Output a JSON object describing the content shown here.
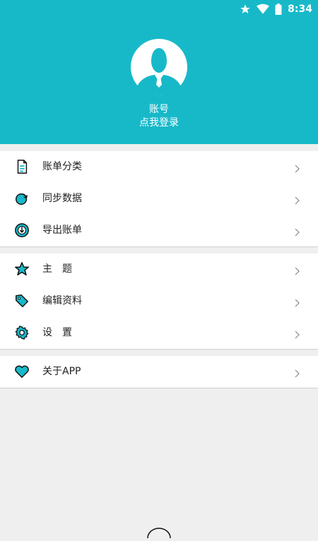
{
  "status_bar": {
    "time": "8:34",
    "icons": [
      "star-icon",
      "wifi-icon",
      "battery-icon"
    ]
  },
  "profile": {
    "title": "账号",
    "subtitle": "点我登录",
    "accent_color": "#17b9c9"
  },
  "menu": {
    "group1": [
      {
        "label": "账单分类",
        "icon": "bill-category-icon"
      },
      {
        "label": "同步数据",
        "icon": "sync-icon"
      },
      {
        "label": "导出账单",
        "icon": "export-icon"
      }
    ],
    "group2": [
      {
        "label": "主　题",
        "icon": "star-icon"
      },
      {
        "label": "编辑资料",
        "icon": "tag-icon"
      },
      {
        "label": "设　置",
        "icon": "gear-icon"
      }
    ],
    "group3": [
      {
        "label": "关于APP",
        "icon": "heart-icon"
      }
    ]
  }
}
